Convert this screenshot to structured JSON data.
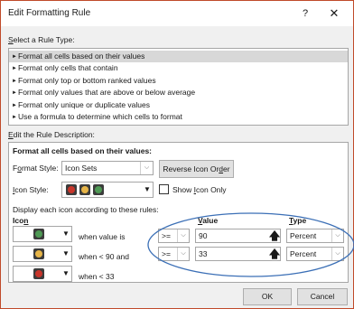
{
  "window": {
    "title": "Edit Formatting Rule",
    "help": "?",
    "close": "✕"
  },
  "rule_type": {
    "label_pre": "",
    "label_key": "S",
    "label_post": "elect a Rule Type:",
    "items": [
      {
        "label": "Format all cells based on their values"
      },
      {
        "label": "Format only cells that contain"
      },
      {
        "label": "Format only top or bottom ranked values"
      },
      {
        "label": "Format only values that are above or below average"
      },
      {
        "label": "Format only unique or duplicate values"
      },
      {
        "label": "Use a formula to determine which cells to format"
      }
    ]
  },
  "description": {
    "label_pre": "",
    "label_key": "E",
    "label_post": "dit the Rule Description:",
    "heading": "Format all cells based on their values:",
    "format_style": {
      "label_pre": "F",
      "label_key": "o",
      "label_post": "rmat Style:",
      "value": "Icon Sets"
    },
    "reverse_button": {
      "pre": "Reverse Icon Or",
      "key": "d",
      "post": "er"
    },
    "icon_style": {
      "label_pre": "",
      "label_key": "I",
      "label_post": "con Style:"
    },
    "show_icon_only": {
      "pre": "Show ",
      "key": "I",
      "post": "con Only"
    },
    "display_text": "Display each icon according to these rules:",
    "col_icon": {
      "pre": "Ico",
      "key": "n",
      "post": ""
    },
    "col_value": {
      "pre": "",
      "key": "V",
      "post": "alue"
    },
    "col_type": {
      "pre": "",
      "key": "T",
      "post": "ype"
    },
    "rules": [
      {
        "when": "when value is",
        "operator": ">=",
        "value": "90",
        "type": "Percent"
      },
      {
        "when": "when < 90 and",
        "operator": ">=",
        "value": "33",
        "type": "Percent"
      },
      {
        "when": "when < 33"
      }
    ]
  },
  "buttons": {
    "ok": "OK",
    "cancel": "Cancel"
  },
  "colors": {
    "red": "#c8352a",
    "yellow": "#e7b548",
    "green": "#4f9a55",
    "annotation": "#3b6fb6",
    "border_accent": "#c04a2a"
  }
}
